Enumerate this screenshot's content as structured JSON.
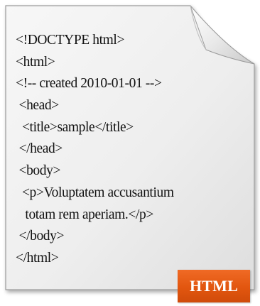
{
  "document": {
    "code_lines": [
      "<!DOCTYPE html>",
      "<html>",
      "<!-- created 2010-01-01 -->",
      " <head>",
      "  <title>sample</title>",
      " </head>",
      " <body>",
      "  <p>Voluptatem accusantium",
      "   totam rem aperiam.</p>",
      " </body>",
      "</html>"
    ],
    "icon": "document-page-icon"
  },
  "badge": {
    "label": "HTML",
    "color": "#e85a14"
  }
}
